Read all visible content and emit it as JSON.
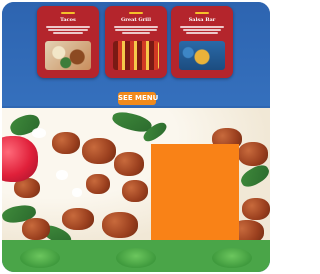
{
  "cards": [
    {
      "title": "Tacos",
      "image_name": "tacos-photo"
    },
    {
      "title": "Great Grill",
      "image_name": "grill-photo"
    },
    {
      "title": "Salsa Bar",
      "image_name": "salsa-bar-photo"
    }
  ],
  "cta": {
    "label": "SEE MENU"
  },
  "colors": {
    "hero_blue": "#2f67b2",
    "card_red": "#b4252c",
    "accent_yellow": "#f5c02a",
    "cta_orange": "#f08a1c",
    "panel_orange": "#f98217",
    "footer_green": "#4aa548"
  }
}
